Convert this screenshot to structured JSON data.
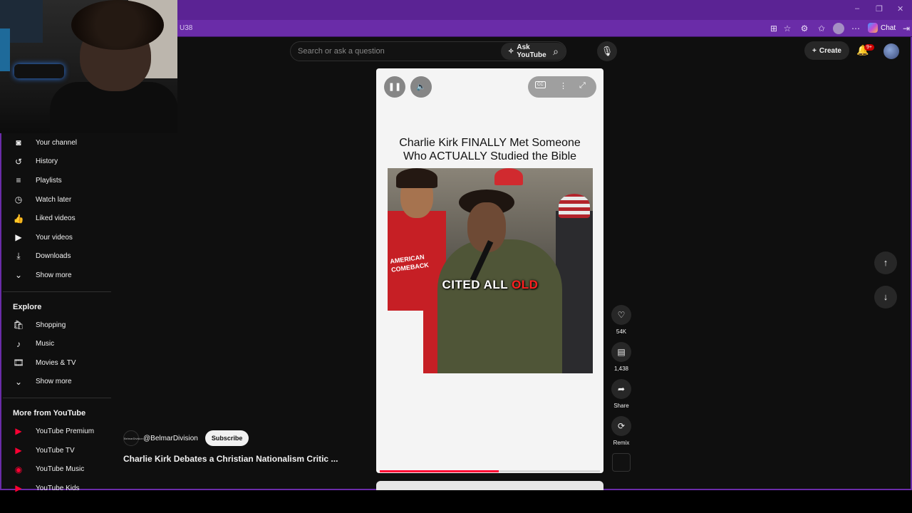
{
  "browser": {
    "address_fragment": "U38",
    "chat_label": "Chat",
    "window_controls": [
      "–",
      "❐",
      "✕"
    ]
  },
  "header": {
    "search_placeholder": "Search or ask a question",
    "ask_label": "Ask YouTube",
    "create_label": "Create",
    "notification_badge": "9+"
  },
  "sidebar": {
    "you_items": [
      {
        "label": "Your channel",
        "icon": "person-box-icon"
      },
      {
        "label": "History",
        "icon": "history-icon"
      },
      {
        "label": "Playlists",
        "icon": "playlists-icon"
      },
      {
        "label": "Watch later",
        "icon": "clock-icon"
      },
      {
        "label": "Liked videos",
        "icon": "thumbs-up-icon"
      },
      {
        "label": "Your videos",
        "icon": "video-icon"
      },
      {
        "label": "Downloads",
        "icon": "download-icon"
      },
      {
        "label": "Show more",
        "icon": "chevron-down-icon"
      }
    ],
    "explore_heading": "Explore",
    "explore_items": [
      {
        "label": "Shopping",
        "icon": "shopping-bag-icon"
      },
      {
        "label": "Music",
        "icon": "music-note-icon"
      },
      {
        "label": "Movies & TV",
        "icon": "film-icon"
      },
      {
        "label": "Show more",
        "icon": "chevron-down-icon"
      }
    ],
    "more_heading": "More from YouTube",
    "more_items": [
      {
        "label": "YouTube Premium",
        "icon": "youtube-premium-icon"
      },
      {
        "label": "YouTube TV",
        "icon": "youtube-tv-icon"
      },
      {
        "label": "YouTube Music",
        "icon": "youtube-music-icon"
      },
      {
        "label": "YouTube Kids",
        "icon": "youtube-kids-icon"
      }
    ]
  },
  "short": {
    "overlay_title_line1": "Charlie Kirk FINALLY Met Someone",
    "overlay_title_line2": "Who ACTUALLY Studied the Bible",
    "caption_white": "CITED ALL ",
    "caption_red": "OLD",
    "jacket_text": "AMERICAN COMEBACK",
    "progress": 0.54,
    "channel_handle": "@BelmarDivision",
    "subscribe_label": "Subscribe",
    "video_title": "Charlie Kirk Debates a Christian Nationalism Critic ..."
  },
  "actions": {
    "likes": "54K",
    "comments": "1,438",
    "share_label": "Share",
    "remix_label": "Remix"
  },
  "colors": {
    "browser_accent": "#6a2ca8",
    "yt_red": "#ff0033",
    "background": "#0f0f0f"
  }
}
